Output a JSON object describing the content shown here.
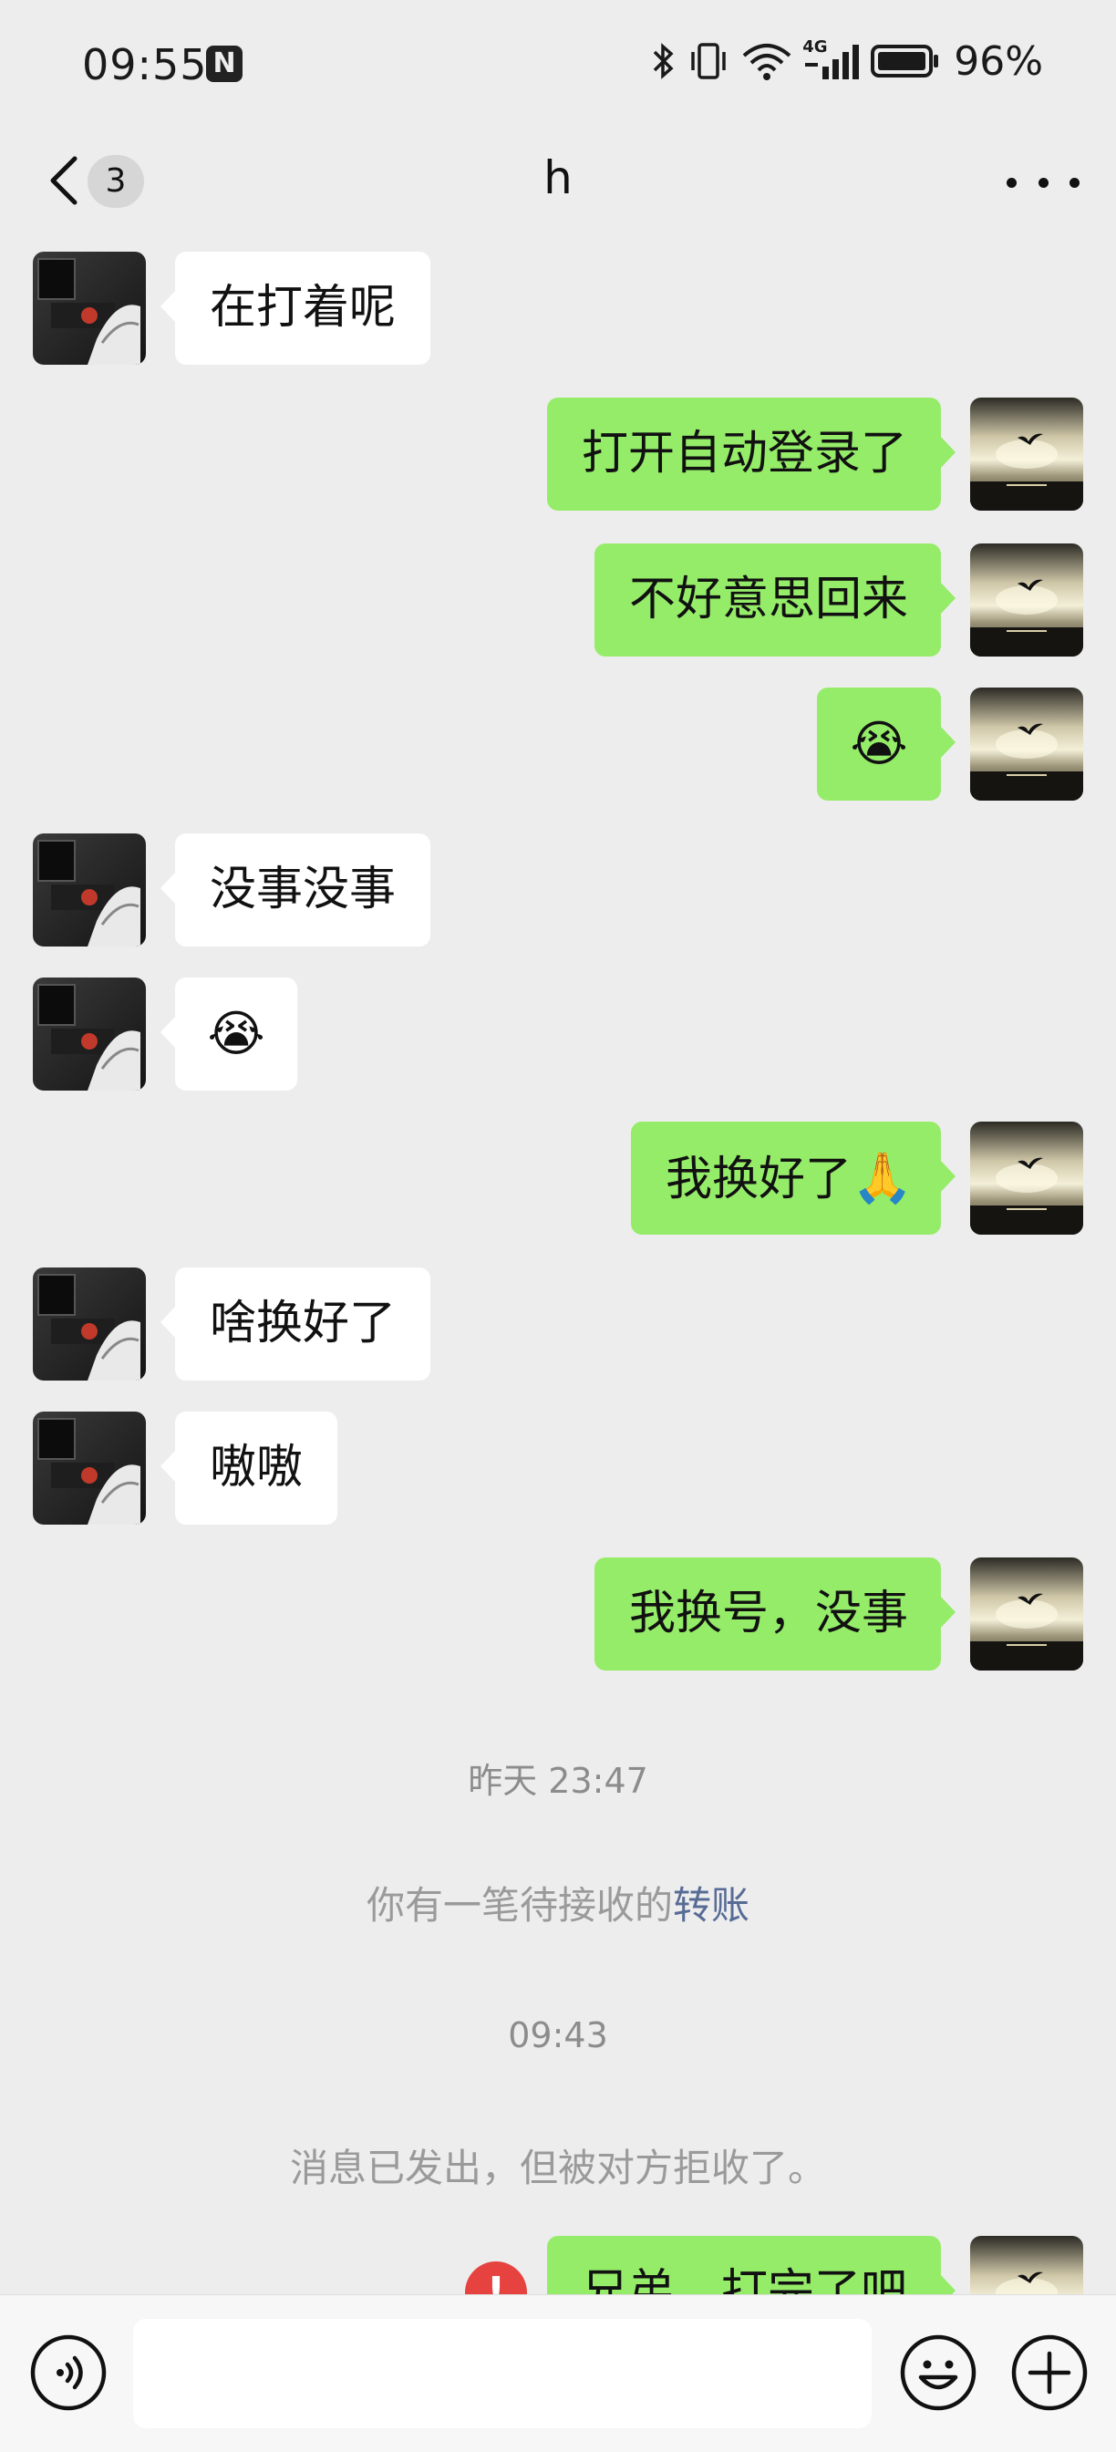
{
  "status_bar": {
    "time": "09:55",
    "nfc_label": "N",
    "network_label": "4G",
    "battery": "96%",
    "icons": [
      "nfc-icon",
      "bluetooth-icon",
      "vibrate-icon",
      "wifi-icon",
      "cellular-signal-icon",
      "battery-icon"
    ]
  },
  "nav": {
    "back_icon": "chevron-left-icon",
    "unread_count": "3",
    "title": "h",
    "more_icon": "more-dots-icon"
  },
  "messages": [
    {
      "side": "in",
      "text": "在打着呢"
    },
    {
      "side": "out",
      "text": "打开自动登录了"
    },
    {
      "side": "out",
      "text": "不好意思回来"
    },
    {
      "side": "out",
      "emoji": "😭"
    },
    {
      "side": "in",
      "text": "没事没事"
    },
    {
      "side": "in",
      "emoji": "😭"
    },
    {
      "side": "out",
      "text": "我换好了",
      "emoji": "🙏"
    },
    {
      "side": "in",
      "text": "啥换好了"
    },
    {
      "side": "in",
      "text": "嗷嗷"
    },
    {
      "side": "out",
      "text": "我换号，没事"
    }
  ],
  "system": {
    "time_1": "昨天 23:47",
    "transfer_prefix": "你有一笔待接收的",
    "transfer_link": "转账",
    "time_2": "09:43",
    "rejected_notice": "消息已发出，但被对方拒收了。"
  },
  "last_message": {
    "side": "out",
    "text": "兄弟，打完了吧",
    "status": "failed",
    "status_icon": "exclamation-icon",
    "status_glyph": "!"
  },
  "input_bar": {
    "text_value": "",
    "voice_icon": "voice-icon",
    "emoji_icon": "smiley-icon",
    "plus_icon": "plus-circle-icon"
  },
  "colors": {
    "background": "#ededed",
    "outgoing_bubble": "#95ec69",
    "incoming_bubble": "#ffffff",
    "link": "#576b95",
    "error": "#e64340"
  }
}
